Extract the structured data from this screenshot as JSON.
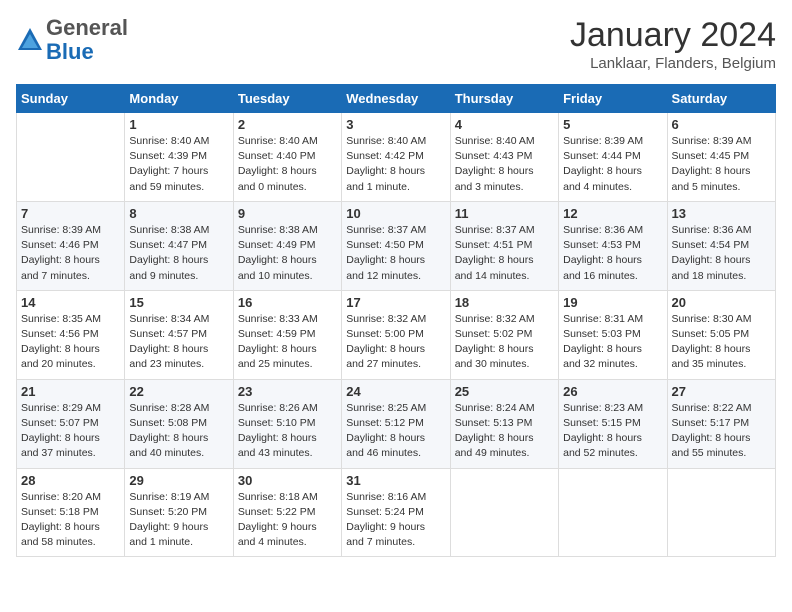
{
  "header": {
    "logo_general": "General",
    "logo_blue": "Blue",
    "month_title": "January 2024",
    "subtitle": "Lanklaar, Flanders, Belgium"
  },
  "days_of_week": [
    "Sunday",
    "Monday",
    "Tuesday",
    "Wednesday",
    "Thursday",
    "Friday",
    "Saturday"
  ],
  "weeks": [
    [
      {
        "day": "",
        "details": ""
      },
      {
        "day": "1",
        "details": "Sunrise: 8:40 AM\nSunset: 4:39 PM\nDaylight: 7 hours\nand 59 minutes."
      },
      {
        "day": "2",
        "details": "Sunrise: 8:40 AM\nSunset: 4:40 PM\nDaylight: 8 hours\nand 0 minutes."
      },
      {
        "day": "3",
        "details": "Sunrise: 8:40 AM\nSunset: 4:42 PM\nDaylight: 8 hours\nand 1 minute."
      },
      {
        "day": "4",
        "details": "Sunrise: 8:40 AM\nSunset: 4:43 PM\nDaylight: 8 hours\nand 3 minutes."
      },
      {
        "day": "5",
        "details": "Sunrise: 8:39 AM\nSunset: 4:44 PM\nDaylight: 8 hours\nand 4 minutes."
      },
      {
        "day": "6",
        "details": "Sunrise: 8:39 AM\nSunset: 4:45 PM\nDaylight: 8 hours\nand 5 minutes."
      }
    ],
    [
      {
        "day": "7",
        "details": "Sunrise: 8:39 AM\nSunset: 4:46 PM\nDaylight: 8 hours\nand 7 minutes."
      },
      {
        "day": "8",
        "details": "Sunrise: 8:38 AM\nSunset: 4:47 PM\nDaylight: 8 hours\nand 9 minutes."
      },
      {
        "day": "9",
        "details": "Sunrise: 8:38 AM\nSunset: 4:49 PM\nDaylight: 8 hours\nand 10 minutes."
      },
      {
        "day": "10",
        "details": "Sunrise: 8:37 AM\nSunset: 4:50 PM\nDaylight: 8 hours\nand 12 minutes."
      },
      {
        "day": "11",
        "details": "Sunrise: 8:37 AM\nSunset: 4:51 PM\nDaylight: 8 hours\nand 14 minutes."
      },
      {
        "day": "12",
        "details": "Sunrise: 8:36 AM\nSunset: 4:53 PM\nDaylight: 8 hours\nand 16 minutes."
      },
      {
        "day": "13",
        "details": "Sunrise: 8:36 AM\nSunset: 4:54 PM\nDaylight: 8 hours\nand 18 minutes."
      }
    ],
    [
      {
        "day": "14",
        "details": "Sunrise: 8:35 AM\nSunset: 4:56 PM\nDaylight: 8 hours\nand 20 minutes."
      },
      {
        "day": "15",
        "details": "Sunrise: 8:34 AM\nSunset: 4:57 PM\nDaylight: 8 hours\nand 23 minutes."
      },
      {
        "day": "16",
        "details": "Sunrise: 8:33 AM\nSunset: 4:59 PM\nDaylight: 8 hours\nand 25 minutes."
      },
      {
        "day": "17",
        "details": "Sunrise: 8:32 AM\nSunset: 5:00 PM\nDaylight: 8 hours\nand 27 minutes."
      },
      {
        "day": "18",
        "details": "Sunrise: 8:32 AM\nSunset: 5:02 PM\nDaylight: 8 hours\nand 30 minutes."
      },
      {
        "day": "19",
        "details": "Sunrise: 8:31 AM\nSunset: 5:03 PM\nDaylight: 8 hours\nand 32 minutes."
      },
      {
        "day": "20",
        "details": "Sunrise: 8:30 AM\nSunset: 5:05 PM\nDaylight: 8 hours\nand 35 minutes."
      }
    ],
    [
      {
        "day": "21",
        "details": "Sunrise: 8:29 AM\nSunset: 5:07 PM\nDaylight: 8 hours\nand 37 minutes."
      },
      {
        "day": "22",
        "details": "Sunrise: 8:28 AM\nSunset: 5:08 PM\nDaylight: 8 hours\nand 40 minutes."
      },
      {
        "day": "23",
        "details": "Sunrise: 8:26 AM\nSunset: 5:10 PM\nDaylight: 8 hours\nand 43 minutes."
      },
      {
        "day": "24",
        "details": "Sunrise: 8:25 AM\nSunset: 5:12 PM\nDaylight: 8 hours\nand 46 minutes."
      },
      {
        "day": "25",
        "details": "Sunrise: 8:24 AM\nSunset: 5:13 PM\nDaylight: 8 hours\nand 49 minutes."
      },
      {
        "day": "26",
        "details": "Sunrise: 8:23 AM\nSunset: 5:15 PM\nDaylight: 8 hours\nand 52 minutes."
      },
      {
        "day": "27",
        "details": "Sunrise: 8:22 AM\nSunset: 5:17 PM\nDaylight: 8 hours\nand 55 minutes."
      }
    ],
    [
      {
        "day": "28",
        "details": "Sunrise: 8:20 AM\nSunset: 5:18 PM\nDaylight: 8 hours\nand 58 minutes."
      },
      {
        "day": "29",
        "details": "Sunrise: 8:19 AM\nSunset: 5:20 PM\nDaylight: 9 hours\nand 1 minute."
      },
      {
        "day": "30",
        "details": "Sunrise: 8:18 AM\nSunset: 5:22 PM\nDaylight: 9 hours\nand 4 minutes."
      },
      {
        "day": "31",
        "details": "Sunrise: 8:16 AM\nSunset: 5:24 PM\nDaylight: 9 hours\nand 7 minutes."
      },
      {
        "day": "",
        "details": ""
      },
      {
        "day": "",
        "details": ""
      },
      {
        "day": "",
        "details": ""
      }
    ]
  ]
}
